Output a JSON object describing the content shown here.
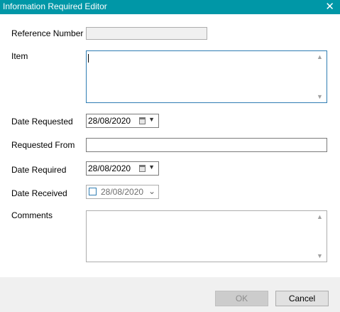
{
  "window": {
    "title": "Information Required Editor",
    "close_symbol": "✕"
  },
  "labels": {
    "reference_number": "Reference Number",
    "item": "Item",
    "date_requested": "Date Requested",
    "requested_from": "Requested From",
    "date_required": "Date Required",
    "date_received": "Date Received",
    "comments": "Comments"
  },
  "fields": {
    "reference_number": "",
    "item": "",
    "date_requested": "28/08/2020",
    "requested_from": "",
    "date_required": "28/08/2020",
    "date_received": "28/08/2020",
    "date_received_checked": false,
    "comments": ""
  },
  "buttons": {
    "ok": "OK",
    "cancel": "Cancel",
    "ok_enabled": false
  },
  "icons": {
    "calendar": "calendar-icon",
    "dropdown": "dropdown-arrow-icon",
    "scroll_up": "scroll-up-icon",
    "scroll_down": "scroll-down-icon"
  },
  "colors": {
    "titlebar": "#0097a7",
    "focus_border": "#2f7db3",
    "footer": "#f0f0f0"
  }
}
